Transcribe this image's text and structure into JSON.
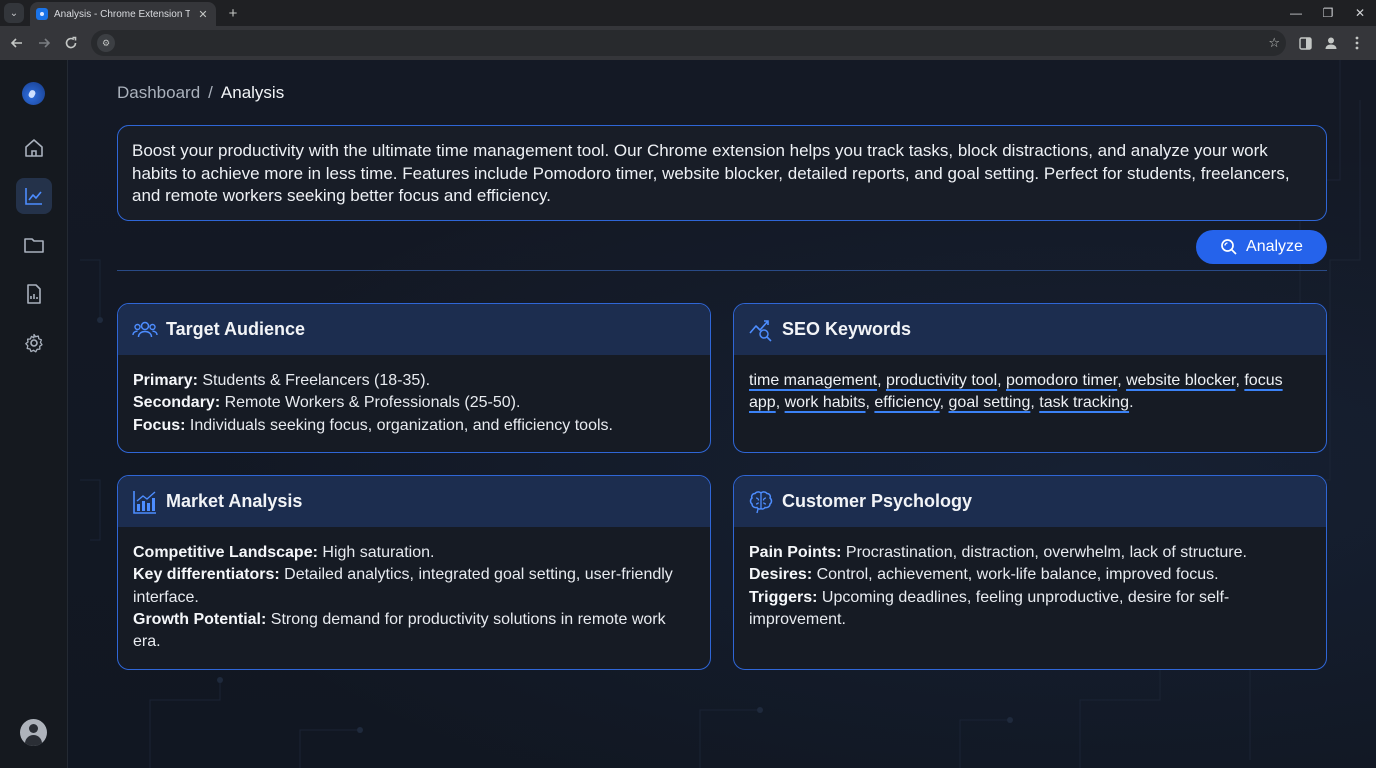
{
  "browser": {
    "tab_title": "Analysis - Chrome Extension Tool",
    "tab_close": "✕",
    "new_tab": "+",
    "minimize": "—",
    "restore": "❐",
    "close": "✕",
    "url": ""
  },
  "sidebar": {
    "items": [
      {
        "name": "home",
        "icon": "home-icon",
        "active": false
      },
      {
        "name": "analysis",
        "icon": "chart-line-icon",
        "active": true
      },
      {
        "name": "folder",
        "icon": "folder-icon",
        "active": false
      },
      {
        "name": "reports",
        "icon": "report-icon",
        "active": false
      },
      {
        "name": "settings",
        "icon": "gear-icon",
        "active": false
      }
    ]
  },
  "breadcrumb": {
    "parent": "Dashboard",
    "separator": "/",
    "current": "Analysis"
  },
  "description": "Boost your productivity with the ultimate time management tool. Our Chrome extension helps you track tasks, block distractions, and analyze your work habits to achieve more in less time. Features include Pomodoro timer, website blocker, detailed reports, and goal setting. Perfect for students, freelancers, and remote workers seeking better focus and efficiency.",
  "analyze_button": "Analyze",
  "cards": {
    "target": {
      "title": "Target Audience",
      "primary_label": "Primary:",
      "primary_value": " Students & Freelancers (18-35).",
      "secondary_label": "Secondary:",
      "secondary_value": " Remote Workers & Professionals (25-50).",
      "focus_label": "Focus:",
      "focus_value": " Individuals seeking focus, organization, and efficiency tools."
    },
    "seo": {
      "title": "SEO Keywords",
      "keywords": [
        "time management",
        "productivity tool",
        "pomodoro timer",
        "website blocker",
        "focus app",
        "work habits",
        "efficiency",
        "goal setting",
        "task tracking"
      ]
    },
    "market": {
      "title": "Market Analysis",
      "competitive_label": "Competitive Landscape:",
      "competitive_value": " High saturation.",
      "diff_label": "Key differentiators:",
      "diff_value": " Detailed analytics, integrated goal setting, user-friendly interface.",
      "growth_label": "Growth Potential:",
      "growth_value": " Strong demand for productivity solutions in remote work era."
    },
    "psychology": {
      "title": "Customer Psychology",
      "pain_label": "Pain Points:",
      "pain_value": " Procrastination, distraction, overwhelm, lack of structure.",
      "desires_label": "Desires:",
      "desires_value": " Control, achievement, work-life balance, improved focus.",
      "triggers_label": "Triggers:",
      "triggers_value": " Upcoming deadlines, feeling unproductive, desire for self-improvement."
    }
  },
  "colors": {
    "accent": "#2563eb",
    "border": "#2f66d6",
    "card_header": "#1c2d4f",
    "background": "#12151c"
  }
}
